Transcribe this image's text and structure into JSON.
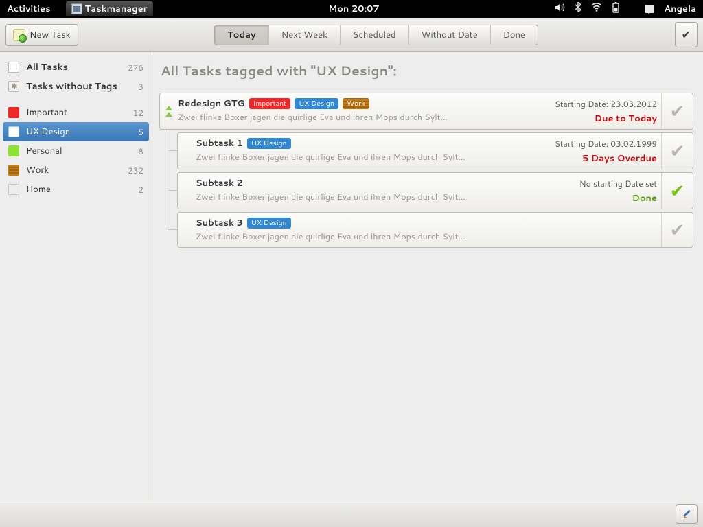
{
  "panel": {
    "activities": "Activities",
    "app_name": "Taskmanager",
    "clock": "Mon 20:07",
    "username": "Angela"
  },
  "toolbar": {
    "new_task": "New Task",
    "filters": [
      "Today",
      "Next Week",
      "Scheduled",
      "Without Date",
      "Done"
    ],
    "active_filter": 0
  },
  "colors": {
    "important": "#ef2929",
    "ux_design": "#2f87d6",
    "personal": "#8ae234",
    "work": "#c17d11",
    "home_empty": "#ededed",
    "home_border": "#c9c6c0",
    "selection": "#4a87c4"
  },
  "sidebar": {
    "groups": {
      "all": {
        "label": "All Tasks",
        "count": 276
      },
      "untagged": {
        "label": "Tasks without Tags",
        "count": 3
      }
    },
    "tags": [
      {
        "id": "important",
        "label": "Important",
        "count": 12,
        "color": "#ef2929",
        "filled": true
      },
      {
        "id": "ux_design",
        "label": "UX Design",
        "count": 5,
        "color": "#2f87d6",
        "filled": false,
        "selected": true,
        "border": "#a7c7e6"
      },
      {
        "id": "personal",
        "label": "Personal",
        "count": 8,
        "color": "#8ae234",
        "filled": true
      },
      {
        "id": "work",
        "label": "Work",
        "count": 232,
        "color": "#c17d11",
        "filled": true,
        "striped": true
      },
      {
        "id": "home",
        "label": "Home",
        "count": 2,
        "color": "#ededed",
        "filled": false,
        "border": "#c9c6c0"
      }
    ]
  },
  "content": {
    "heading": "All Tasks tagged with \"UX Design\":",
    "lorem": "Zwei flinke Boxer jagen die quirlige Eva und ihren Mops durch Sylt...",
    "tasks": [
      {
        "id": "redesign",
        "title": "Redesign GTG",
        "tags": [
          {
            "label": "Important",
            "color": "#ef2929"
          },
          {
            "label": "UX Design",
            "color": "#2f87d6"
          },
          {
            "label": "Work",
            "color": "#c17d11",
            "striped": true
          }
        ],
        "date_line": "Starting Date: 23.03.2012",
        "status": "Due to Today",
        "status_class": "status-red",
        "priority_chevrons": 2,
        "indent": 0,
        "done": false
      },
      {
        "id": "sub1",
        "title": "Subtask 1",
        "tags": [
          {
            "label": "UX Design",
            "color": "#2f87d6"
          }
        ],
        "date_line": "Starting Date: 03.02.1999",
        "status": "5 Days Overdue",
        "status_class": "status-red",
        "indent": 1,
        "done": false
      },
      {
        "id": "sub2",
        "title": "Subtask 2",
        "tags": [],
        "date_line": "No starting Date set",
        "status": "Done",
        "status_class": "status-green",
        "indent": 1,
        "done": true
      },
      {
        "id": "sub3",
        "title": "Subtask 3",
        "tags": [
          {
            "label": "UX Design",
            "color": "#2f87d6"
          }
        ],
        "date_line": "",
        "status": "",
        "status_class": "",
        "indent": 1,
        "done": false
      }
    ]
  }
}
